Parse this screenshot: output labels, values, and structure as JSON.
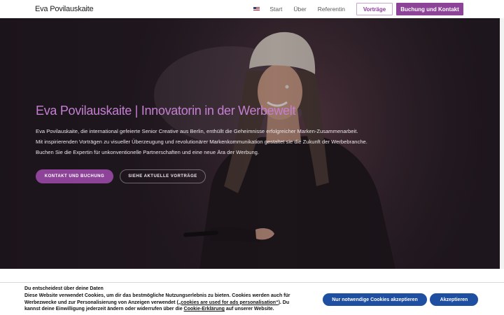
{
  "header": {
    "logo": "Eva Povilauskaite",
    "nav": [
      "Start",
      "Über",
      "Referentin"
    ],
    "talks_button": "Vorträge",
    "booking_button": "Buchung und Kontakt"
  },
  "hero": {
    "title": "Eva Povilauskaite | Innovatorin in der Werbewelt",
    "lines": [
      "Eva Povilauskaite, die international gefeierte Senior Creative aus Berlin, enthüllt die Geheimnisse erfolgreicher Marken-Zusammenarbeit.",
      "Mit inspirierenden Vorträgen zu visueller Überzeugung und revolutionärer Markenkommunikation gestaltet sie die Zukunft der Werbebranche.",
      "Buchen Sie die Expertin für unkonventionelle Partnerschaften und eine neue Ära der Werbung."
    ],
    "primary_button": "KONTAKT UND BUCHUNG",
    "secondary_button": "SIEHE AKTUELLE VORTRÄGE"
  },
  "cookie": {
    "title": "Du entscheidest über deine Daten",
    "text_part1": "Diese Website verwendet Cookies, um dir das bestmögliche Nutzungserlebnis zu bieten. Cookies werden auch für Werbezwecke und zur Personalisierung von Anzeigen verwendet (",
    "text_link1": "„cookies are used for ads personalisation“",
    "text_part2": "). Du kannst deine Einwilligung jederzeit ändern oder widerrufen über die ",
    "text_link2": "Cookie-Erklärung",
    "text_part3": " auf unserer Website.",
    "necessary_button": "Nur notwendige Cookies akzeptieren",
    "accept_button": "Akzeptieren"
  },
  "colors": {
    "accent": "#8d4498",
    "title": "#c57fd2",
    "cookie_button": "#1e4fa1"
  },
  "icons": {
    "language": "us-flag-icon"
  }
}
